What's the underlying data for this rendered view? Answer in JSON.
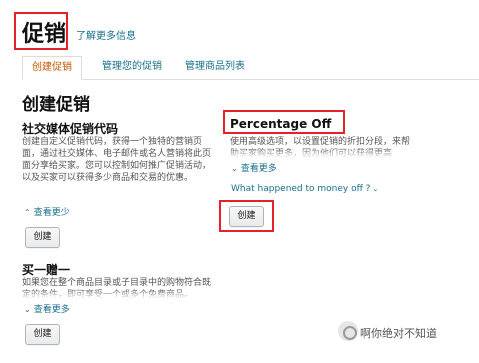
{
  "header": {
    "title": "促销",
    "learn_more": "了解更多信息"
  },
  "tabs": [
    {
      "label": "创建促销",
      "active": true
    },
    {
      "label": "管理您的促销",
      "active": false
    },
    {
      "label": "管理商品列表",
      "active": false
    }
  ],
  "main": {
    "section_title": "创建促销",
    "social": {
      "title": "社交媒体促销代码",
      "description": "创建自定义促销代码，获得一个独特的营销页面，通过社交媒体、电子邮件或名人营销将此页面分享给买家。您可以控制如何推广促销活动，以及买家可以获得多少商品和交易的优惠。",
      "toggle": "查看更少",
      "button": "创建"
    },
    "bogo": {
      "title": "买一赠一",
      "description": "如果您在整个商品目录或子目录中的购物符合既定的条件，即可享受一个或多个免费商品。",
      "toggle": "查看更多",
      "button": "创建"
    },
    "percentage": {
      "title": "Percentage Off",
      "description": "使用高级选项，以设置促销的折扣分段，来帮助买家购买更多，因为他们可以获得更高",
      "toggle": "查看更多",
      "faq": "What happened to money off ?",
      "button": "创建"
    }
  },
  "watermark": "啊你绝对不知道",
  "colors": {
    "highlight_border": "#e3222b",
    "link": "#1a6e8e",
    "active_tab": "#c45500"
  }
}
